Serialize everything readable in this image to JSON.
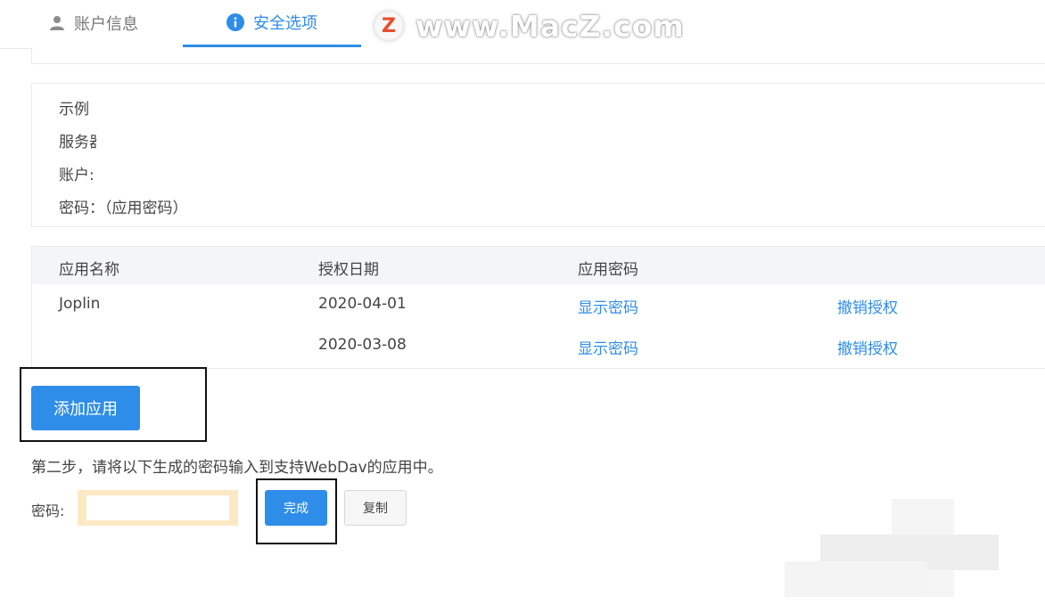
{
  "tabs": [
    {
      "label": "账户信息",
      "icon": "user-icon",
      "active": false
    },
    {
      "label": "安全选项",
      "icon": "info-icon",
      "active": true
    }
  ],
  "watermark": {
    "logo": "Z",
    "text": "www.MacZ.com"
  },
  "example": {
    "line1": "示例",
    "line2": "服务器",
    "line3": "账户:",
    "line4": "密码：（应用密码）"
  },
  "table": {
    "headers": {
      "name": "应用名称",
      "date": "授权日期",
      "password": "应用密码"
    },
    "rows": [
      {
        "name": "Joplin",
        "date": "2020-04-01",
        "password_link": "显示密码",
        "action": "撤销授权"
      },
      {
        "name": "",
        "date": "2020-03-08",
        "password_link": "显示密码",
        "action": "撤销授权"
      }
    ]
  },
  "add_button": "添加应用",
  "step2": {
    "instruction": "第二步，请将以下生成的密码输入到支持WebDav的应用中。",
    "password_label": "密码:",
    "password_value": "",
    "done_button": "完成",
    "copy_button": "复制"
  },
  "colors": {
    "accent": "#2e8de8",
    "password_highlight": "#fce9c4",
    "watermark_logo": "#e94b2d"
  }
}
